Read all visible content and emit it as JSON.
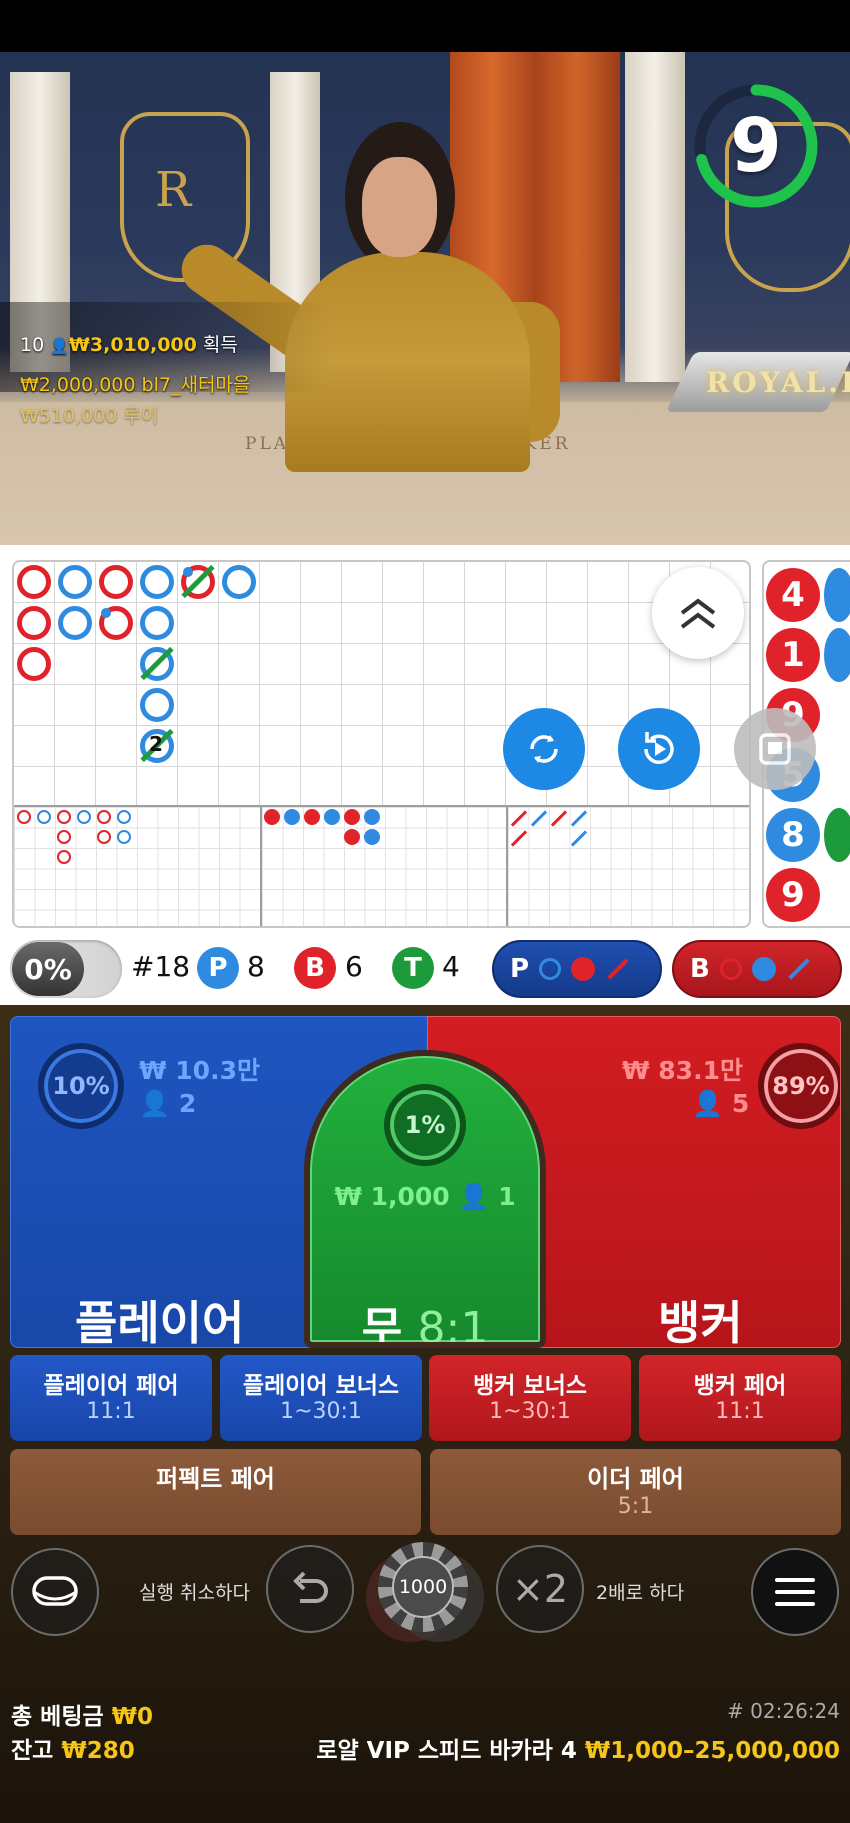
{
  "timer": {
    "value": "9"
  },
  "winners": [
    {
      "rank_count": "10",
      "amount": "₩3,010,000",
      "suffix": "획득"
    },
    {
      "amount": "₩2,000,000",
      "name": "bl7_새터마을"
    },
    {
      "amount": "₩510,000",
      "name": "루이"
    }
  ],
  "video": {
    "sign": "ROYAL.I",
    "felt_player": "PLAYER",
    "felt_banker": "BANKER"
  },
  "roadmap": {
    "tie_count_label": "2"
  },
  "side_beads": [
    "4",
    "1",
    "9",
    "5",
    "8",
    "9"
  ],
  "stats": {
    "percent": "0%",
    "round": "#18",
    "player_letter": "P",
    "player_count": "8",
    "banker_letter": "B",
    "banker_count": "6",
    "tie_letter": "T",
    "tie_count": "4",
    "player_ask": "P",
    "banker_ask": "B"
  },
  "bets": {
    "player": {
      "percent": "10%",
      "amount": "₩ 10.3만",
      "players": "2",
      "label": "플레이어"
    },
    "tie": {
      "percent": "1%",
      "amount": "₩ 1,000",
      "players": "1",
      "label": "무",
      "odds": "8:1"
    },
    "banker": {
      "percent": "89%",
      "amount": "₩ 83.1만",
      "players": "5",
      "label": "뱅커"
    }
  },
  "side_bets": [
    {
      "label": "플레이어 페어",
      "odds": "11:1"
    },
    {
      "label": "플레이어 보너스",
      "odds": "1~30:1"
    },
    {
      "label": "뱅커 보너스",
      "odds": "1~30:1"
    },
    {
      "label": "뱅커 페어",
      "odds": "11:1"
    }
  ],
  "extra_bets": [
    {
      "label": "퍼펙트 페어",
      "odds": ""
    },
    {
      "label": "이더 페어",
      "odds": "5:1"
    }
  ],
  "controls": {
    "undo_label": "실행 취소하다",
    "chip_value": "1000",
    "double_symbol": "×2",
    "double_label": "2배로 하다"
  },
  "footer": {
    "total_bet_label": "총 베팅금",
    "total_bet_value": "₩0",
    "balance_label": "잔고",
    "balance_value": "₩280",
    "game_id": "# 02:26:24",
    "table_name": "로얄 VIP 스피드 바카라 4",
    "limits": "₩1,000–25,000,000"
  },
  "colors": {
    "player": "#1f5fc9",
    "banker": "#d01a1f",
    "tie": "#1d9a3c",
    "accent": "#f5c518"
  }
}
